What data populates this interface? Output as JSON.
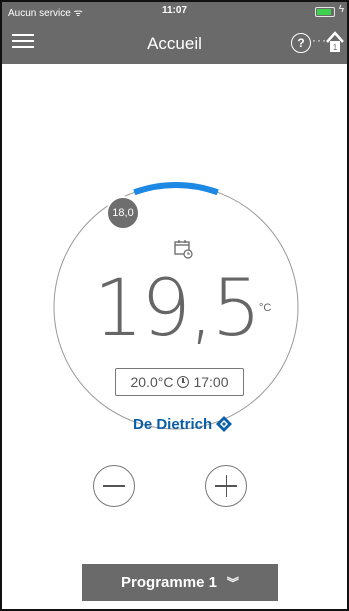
{
  "status_bar": {
    "carrier": "Aucun service",
    "time": "11:07",
    "battery_level": 0.8
  },
  "header": {
    "title": "Accueil",
    "help_label": "?"
  },
  "thermostat": {
    "setpoint": "18,0",
    "current_temp": "19,5",
    "unit": "°C",
    "next_temp": "20.0°C",
    "next_time": "17:00",
    "progress": 0.2,
    "accent_color": "#1e88e5"
  },
  "brand": {
    "name": "De Dietrich"
  },
  "controls": {
    "minus_icon": "minus-icon",
    "plus_icon": "plus-icon"
  },
  "program": {
    "label": "Programme 1",
    "icon": "double-chevron-down-icon"
  }
}
